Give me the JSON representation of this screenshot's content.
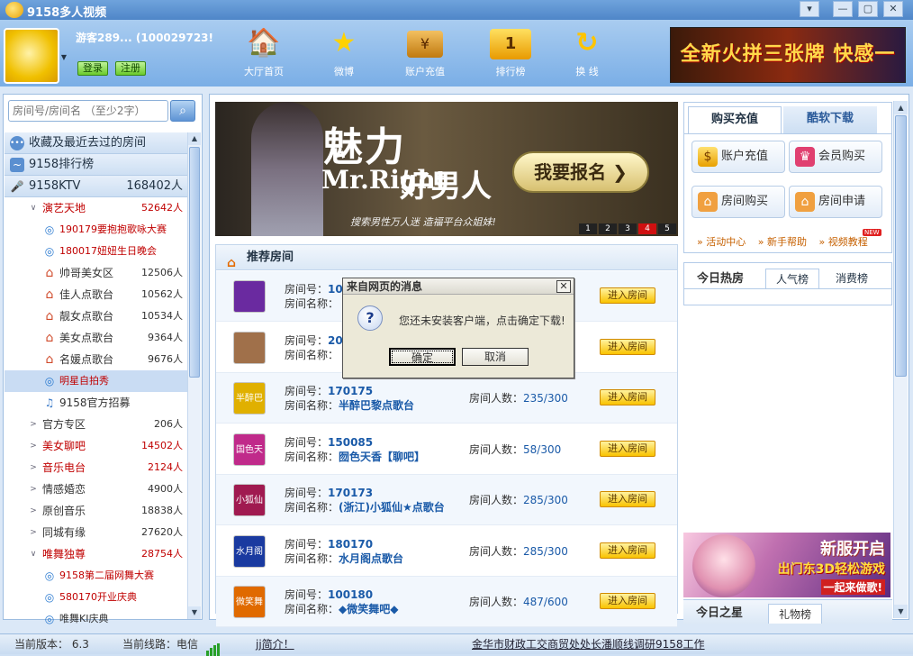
{
  "app": {
    "title": "9158多人视频"
  },
  "window_buttons": [
    "▾",
    "—",
    "▢",
    "✕"
  ],
  "user": {
    "name": "游客289... (100029723!",
    "login": "登录",
    "register": "注册"
  },
  "nav": [
    {
      "label": "大厅首页",
      "icon": "house-icon"
    },
    {
      "label": "微博",
      "icon": "star-icon"
    },
    {
      "label": "账户充值",
      "icon": "wallet-icon"
    },
    {
      "label": "排行榜",
      "icon": "ranking-icon"
    },
    {
      "label": "换 线",
      "icon": "switch-line-icon"
    }
  ],
  "top_ad": {
    "text": "全新火拼三张牌 快感一瞬间"
  },
  "sidebar": {
    "search_placeholder": "房间号/房间名 （至少2字）",
    "sections": [
      {
        "label": "收藏及最近去过的房间"
      },
      {
        "label": "9158排行榜"
      }
    ],
    "ktv": {
      "label": "9158KTV",
      "count": "168402人"
    },
    "tree": [
      {
        "label": "演艺天地",
        "count": "52642人",
        "level": 1,
        "expanded": true,
        "color": "#c00000"
      },
      {
        "label": "190179要抱抱歌咏大赛",
        "count": "",
        "level": 2,
        "type": "event",
        "color": "#c00000"
      },
      {
        "label": "180017妞妞生日晚会",
        "count": "",
        "level": 2,
        "type": "event",
        "color": "#c00000"
      },
      {
        "label": "帅哥美女区",
        "count": "12506人",
        "level": 2,
        "type": "house",
        "color": "#333"
      },
      {
        "label": "佳人点歌台",
        "count": "10562人",
        "level": 2,
        "type": "house",
        "color": "#333"
      },
      {
        "label": "靓女点歌台",
        "count": "10534人",
        "level": 2,
        "type": "house",
        "color": "#333"
      },
      {
        "label": "美女点歌台",
        "count": "9364人",
        "level": 2,
        "type": "house",
        "color": "#333"
      },
      {
        "label": "名媛点歌台",
        "count": "9676人",
        "level": 2,
        "type": "house",
        "color": "#333"
      },
      {
        "label": "明星自拍秀",
        "count": "",
        "level": 2,
        "type": "event",
        "color": "#c00000",
        "selected": true
      },
      {
        "label": "9158官方招募",
        "count": "",
        "level": 2,
        "type": "music",
        "color": "#333"
      },
      {
        "label": "官方专区",
        "count": "206人",
        "level": 1,
        "expanded": false,
        "color": "#333"
      },
      {
        "label": "美女聊吧",
        "count": "14502人",
        "level": 1,
        "expanded": false,
        "color": "#c00000"
      },
      {
        "label": "音乐电台",
        "count": "2124人",
        "level": 1,
        "expanded": false,
        "color": "#c00000"
      },
      {
        "label": "情感婚恋",
        "count": "4900人",
        "level": 1,
        "expanded": false,
        "color": "#333"
      },
      {
        "label": "原创音乐",
        "count": "18838人",
        "level": 1,
        "expanded": false,
        "color": "#333"
      },
      {
        "label": "同城有缘",
        "count": "27620人",
        "level": 1,
        "expanded": false,
        "color": "#333"
      },
      {
        "label": "唯舞独尊",
        "count": "28754人",
        "level": 1,
        "expanded": true,
        "color": "#c00000"
      },
      {
        "label": "9158第二届网舞大赛",
        "count": "",
        "level": 2,
        "type": "event",
        "color": "#c00000"
      },
      {
        "label": "580170开业庆典",
        "count": "",
        "level": 2,
        "type": "event",
        "color": "#c00000"
      },
      {
        "label": "唯舞KI庆典",
        "count": "",
        "level": 2,
        "type": "event",
        "color": "#333"
      }
    ]
  },
  "banner": {
    "headline": "魅力",
    "mr": "Mr.Right",
    "subline": "好男人",
    "tagline": "搜索男性万人迷 造福平台众姐妹!",
    "join_button": "我要报名",
    "pages": [
      "1",
      "2",
      "3",
      "4",
      "5"
    ],
    "active_page": "4"
  },
  "recommend": {
    "title": "推荐房间",
    "id_label": "房间号：",
    "name_label": "房间名称：",
    "pop_label": "房间人数：",
    "enter_label": "进入房间",
    "rooms": [
      {
        "id": "10",
        "name": "",
        "pop": "",
        "thumb": "",
        "thumb_color": "#6a2aa0"
      },
      {
        "id": "20",
        "name": "",
        "pop": "",
        "thumb": "",
        "thumb_color": "#a0704a"
      },
      {
        "id": "170175",
        "name": "半醉巴黎点歌台",
        "pop": "235/300",
        "thumb": "半醉巴黎",
        "thumb_color": "#e0b000"
      },
      {
        "id": "150085",
        "name": "囫色天香【聊吧】",
        "pop": "58/300",
        "thumb": "国色天香",
        "thumb_color": "#c02a8a"
      },
      {
        "id": "170173",
        "name": "(浙江)小狐仙★点歌台",
        "pop": "285/300",
        "thumb": "小狐仙",
        "thumb_color": "#a01a50"
      },
      {
        "id": "180170",
        "name": "水月阁点歌台",
        "pop": "285/300",
        "thumb": "水月阁",
        "thumb_color": "#1a3aa0"
      },
      {
        "id": "100180",
        "name": "◆微笑舞吧◆",
        "pop": "487/600",
        "thumb": "微笑舞吧",
        "thumb_color": "#e06a00"
      }
    ]
  },
  "right": {
    "tabs": [
      "购买充值",
      "酷软下载"
    ],
    "buttons": [
      "账户充值",
      "会员购买",
      "房间购买",
      "房间申请"
    ],
    "links": [
      "» 活动中心",
      "» 新手帮助",
      "» 视频教程"
    ],
    "new_badge": "NEW",
    "hot_title": "今日热房",
    "hot_tabs": [
      "人气榜",
      "消费榜"
    ],
    "ad": {
      "line1": "新服开启",
      "line2": "出门东3D轻松游戏",
      "line3": "一起来做歌!"
    },
    "star_title": "今日之星",
    "star_tab": "礼物榜"
  },
  "status": {
    "version_label": "当前版本：",
    "version": "6.3",
    "line_label": "当前线路：",
    "line": "电信",
    "intro": "jj简介！",
    "notice": "金华市财政工交商贸处处长潘顺线调研9158工作"
  },
  "dialog": {
    "title": "来自网页的消息",
    "message": "您还未安装客户端，点击确定下载!",
    "ok": "确定",
    "cancel": "取消"
  }
}
